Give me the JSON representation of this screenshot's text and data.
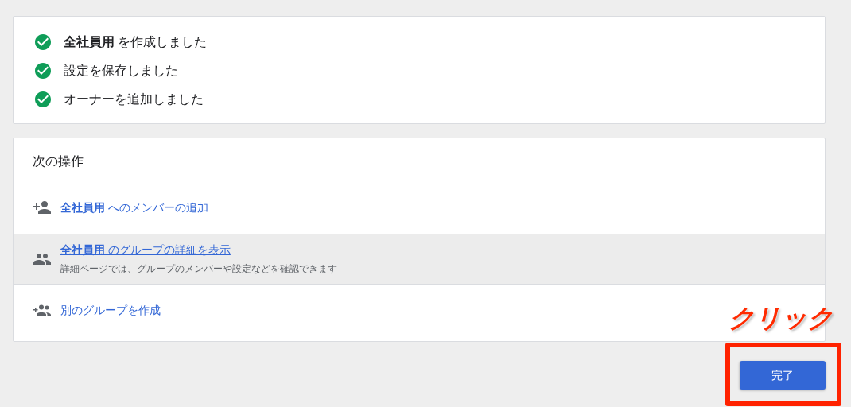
{
  "results": [
    {
      "text": "**全社員用** を作成しました",
      "done": true
    },
    {
      "text": "設定を保存しました",
      "done": true
    },
    {
      "text": "オーナーを追加しました",
      "done": true
    }
  ],
  "next_steps": {
    "title": "次の操作",
    "actions": [
      {
        "kind": "add-member",
        "label": "**全社員用** へのメンバーの追加",
        "highlighted": false
      },
      {
        "kind": "group",
        "label": "**全社員用** のグループの詳細を表示",
        "description": "詳細ページでは、グループのメンバーや設定などを確認できます",
        "highlighted": true
      },
      {
        "kind": "create-group",
        "label": "別のグループを作成",
        "highlighted": false
      }
    ]
  },
  "done_button": "完了",
  "annotation": {
    "text": "クリック"
  }
}
